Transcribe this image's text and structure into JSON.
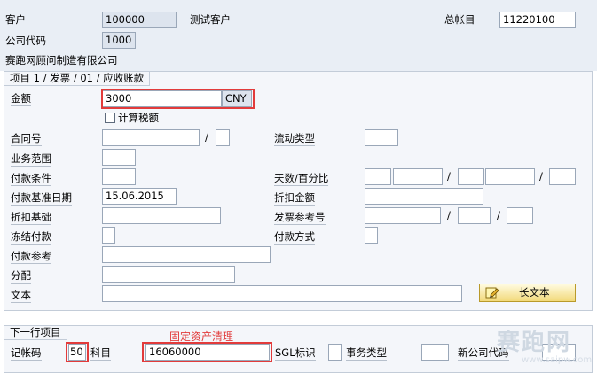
{
  "header": {
    "customer_label": "客户",
    "customer_value": "100000",
    "customer_desc": "测试客户",
    "gl_label": "总帐目",
    "gl_value": "11220100",
    "company_code_label": "公司代码",
    "company_code_value": "1000",
    "company_name": "赛跑网顾问制造有限公司"
  },
  "item_group": {
    "title": "项目 1 / 发票 / 01 / 应收账款",
    "amount_label": "金额",
    "amount_value": "3000",
    "currency": "CNY",
    "calc_tax_label": "计算税额",
    "contract_label": "合同号",
    "flow_type_label": "流动类型",
    "business_area_label": "业务范围",
    "payment_terms_label": "付款条件",
    "days_percent_label": "天数/百分比",
    "baseline_date_label": "付款基准日期",
    "baseline_date_value": "15.06.2015",
    "discount_amount_label": "折扣金额",
    "discount_base_label": "折扣基础",
    "invoice_ref_label": "发票参考号",
    "payment_block_label": "冻结付款",
    "payment_method_label": "付款方式",
    "payment_ref_label": "付款参考",
    "assignment_label": "分配",
    "text_label": "文本",
    "long_text_button": "长文本",
    "slash": "/"
  },
  "next_item": {
    "title": "下一行项目",
    "posting_key_label": "记帐码",
    "posting_key_value": "50",
    "account_label": "科目",
    "account_value": "16060000",
    "sgl_label": "SGL标识",
    "transaction_type_label": "事务类型",
    "new_company_code_label": "新公司代码",
    "annotation": "固定资产清理"
  },
  "watermark": {
    "text": "赛跑网",
    "sub": "www.saipw.com"
  },
  "colors": {
    "highlight": "#e23b3b",
    "header_bg": "#e9eef5",
    "group_bg": "#f4f6fa"
  }
}
